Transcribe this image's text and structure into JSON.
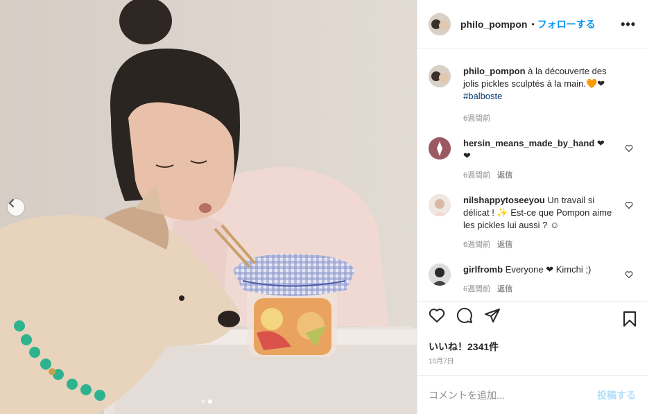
{
  "post": {
    "author": "philo_pompon",
    "follow_label": "フォローする",
    "more_label": "•••",
    "separator": "•"
  },
  "caption": {
    "username": "philo_pompon",
    "text": " à la découverte des jolis pickles sculptés à la main.",
    "emoji": "🧡❤",
    "hashtag": "#balboste",
    "time": "6週間前"
  },
  "comments": [
    {
      "username": "hersin_means_made_by_hand",
      "text": " ❤ ❤",
      "time": "6週間前",
      "reply_label": "返信"
    },
    {
      "username": "nilshappytoseeyou",
      "text": " Un travail si délicat ! ✨ Est-ce que Pompon aime les pickles lui aussi ? ☺",
      "time": "6週間前",
      "reply_label": "返信"
    },
    {
      "username": "girlfromb",
      "text": " Everyone ❤ Kimchi ;)",
      "time": "6週間前",
      "reply_label": "返信"
    }
  ],
  "likes": "いいね！2341件",
  "date": "10月7日",
  "add_comment": {
    "placeholder": "コメントを追加...",
    "post_label": "投稿する"
  },
  "carousel": {
    "count": 2,
    "active_index": 1
  },
  "colors": {
    "accent": "#0095f6",
    "text": "#262626",
    "muted": "#8e8e8e",
    "hashtag": "#00376b",
    "post_disabled": "#b2dffc"
  }
}
